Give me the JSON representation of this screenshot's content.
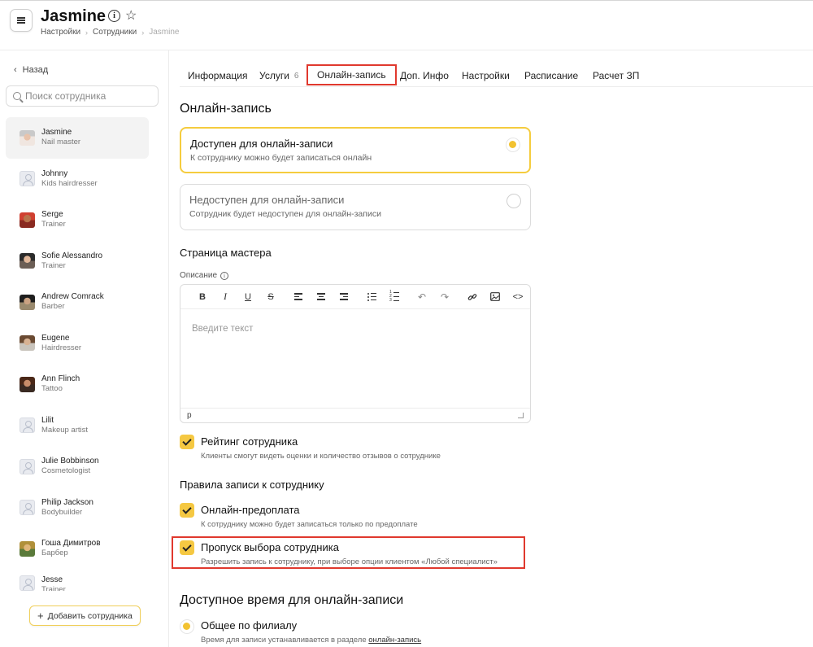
{
  "header": {
    "title": "Jasmine",
    "breadcrumb": [
      "Настройки",
      "Сотрудники",
      "Jasmine"
    ]
  },
  "sidebar": {
    "back_label": "Назад",
    "search_placeholder": "Поиск сотрудника",
    "employees": [
      {
        "name": "Jasmine",
        "role": "Nail master",
        "avatar": "photo"
      },
      {
        "name": "Johnny",
        "role": "Kids hairdresser",
        "avatar": "placeholder"
      },
      {
        "name": "Serge",
        "role": "Trainer",
        "avatar": "photo"
      },
      {
        "name": "Sofie Alessandro",
        "role": "Trainer",
        "avatar": "photo"
      },
      {
        "name": "Andrew Comrack",
        "role": "Barber",
        "avatar": "photo"
      },
      {
        "name": "Eugene",
        "role": "Hairdresser",
        "avatar": "photo"
      },
      {
        "name": "Ann Flinch",
        "role": "Tattoo",
        "avatar": "photo"
      },
      {
        "name": "Lilit",
        "role": "Makeup artist",
        "avatar": "placeholder"
      },
      {
        "name": "Julie Bobbinson",
        "role": "Cosmetologist",
        "avatar": "placeholder"
      },
      {
        "name": "Philip Jackson",
        "role": "Bodybuilder",
        "avatar": "placeholder"
      },
      {
        "name": "Гоша Димитров",
        "role": "Барбер",
        "avatar": "photo"
      },
      {
        "name": "Jesse",
        "role": "Trainer",
        "avatar": "placeholder"
      }
    ],
    "add_button": "Добавить сотрудника"
  },
  "tabs": [
    {
      "label": "Информация"
    },
    {
      "label": "Услуги",
      "count": "6"
    },
    {
      "label": "Онлайн-запись",
      "active": true
    },
    {
      "label": "Доп. Инфо"
    },
    {
      "label": "Настройки"
    },
    {
      "label": "Расписание"
    },
    {
      "label": "Расчет ЗП"
    }
  ],
  "online": {
    "heading": "Онлайн-запись",
    "available": {
      "title": "Доступен для онлайн-записи",
      "desc": "К сотруднику можно будет записаться онлайн",
      "selected": true
    },
    "unavailable": {
      "title": "Недоступен для онлайн-записи",
      "desc": "Сотрудник будет недоступен для онлайн-записи",
      "selected": false
    }
  },
  "master_page": {
    "heading": "Страница мастера",
    "description_label": "Описание",
    "editor_placeholder": "Введите текст",
    "editor_status": "p"
  },
  "rating": {
    "title": "Рейтинг сотрудника",
    "desc": "Клиенты смогут видеть оценки и количество отзывов о сотруднике",
    "checked": true
  },
  "rules": {
    "heading": "Правила записи к сотруднику",
    "prepay": {
      "title": "Онлайн-предоплата",
      "desc": "К сотруднику можно будет записаться только по предоплате",
      "checked": true
    },
    "skip": {
      "title": "Пропуск выбора сотрудника",
      "desc": "Разрешить запись к сотруднику, при выборе опции клиентом «Любой специалист»",
      "checked": true
    }
  },
  "time": {
    "heading": "Доступное время для онлайн-записи",
    "option_title": "Общее по филиалу",
    "option_desc": "Время для записи устанавливается в разделе",
    "option_link": "онлайн-запись"
  },
  "colors": {
    "accent": "#f5c842",
    "highlight": "#e0392e"
  }
}
